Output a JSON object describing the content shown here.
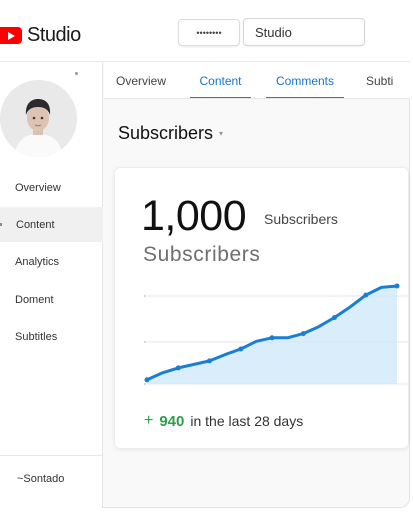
{
  "app": {
    "logo_icon": "youtube-play-icon",
    "logo_text": "Studio",
    "password_mask": "••••••••",
    "search_value": "Studio"
  },
  "sidebar": {
    "items": [
      {
        "label": "Overview",
        "active": false
      },
      {
        "label": "Content",
        "active": true
      },
      {
        "label": "Analytics",
        "active": false
      },
      {
        "label": "Doment",
        "active": false
      },
      {
        "label": "Subtitles",
        "active": false
      }
    ],
    "bottom_label": "~Sontado"
  },
  "tabs": [
    {
      "label": "Overview",
      "selected": false
    },
    {
      "label": "Content",
      "selected": true
    },
    {
      "label": "Comments",
      "selected": true
    },
    {
      "label": "Subti",
      "selected": false
    }
  ],
  "section": {
    "title": "Subscribers",
    "caret_icon": "caret-down-icon"
  },
  "card": {
    "count": "1,000",
    "count_label": "Subscribers",
    "big_label": "Subscribers",
    "gain_prefix": "+",
    "gain_value": "940",
    "gain_text": "in the last 28 days"
  },
  "chart_data": {
    "type": "area",
    "title": "",
    "xlabel": "",
    "ylabel": "",
    "x": [
      1,
      2,
      3,
      4,
      5,
      6,
      7,
      8,
      9,
      10,
      11,
      12,
      13,
      14,
      15,
      16,
      17
    ],
    "values": [
      60,
      160,
      230,
      280,
      330,
      420,
      500,
      610,
      660,
      660,
      720,
      820,
      950,
      1100,
      1270,
      1380,
      1400
    ],
    "ylim": [
      0,
      1400
    ],
    "grid": true,
    "colors": {
      "line": "#1a7fd4",
      "fill": "#cfe8fa"
    }
  }
}
